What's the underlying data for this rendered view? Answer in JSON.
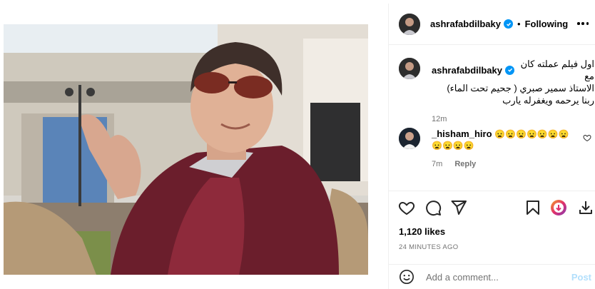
{
  "post": {
    "photo_alt": "",
    "header": {
      "username": "ashrafabdilbaky",
      "separator": "•",
      "follow_status": "Following"
    },
    "caption": {
      "username": "ashrafabdilbaky",
      "lines": [
        "اول فيلم عملته كان مع",
        "الاستاذ سمير صبري ( جحيم تحت الماء)",
        "ربنا يرحمه ويغفرله يارب"
      ],
      "time": "12m"
    },
    "comments": [
      {
        "username": "_hisham_hiro",
        "emoji_line1": "😦😦😦😦😦😦😦",
        "emoji_line2": "😦😦😦😦",
        "time": "7m",
        "reply_label": "Reply"
      }
    ],
    "likes": "1,120 likes",
    "timestamp": "24 MINUTES AGO",
    "add_comment": {
      "placeholder": "Add a comment...",
      "post_label": "Post"
    },
    "icons": {
      "like": "heart-icon",
      "comment": "comment-icon",
      "share": "share-icon",
      "save": "bookmark-icon",
      "more": "more-icon",
      "emoji": "emoji-icon",
      "download": "download-icon",
      "extension": "extension-icon"
    },
    "colors": {
      "verified": "#0095f6",
      "secondary_text": "#737373",
      "post_button": "#b2dffc"
    }
  }
}
